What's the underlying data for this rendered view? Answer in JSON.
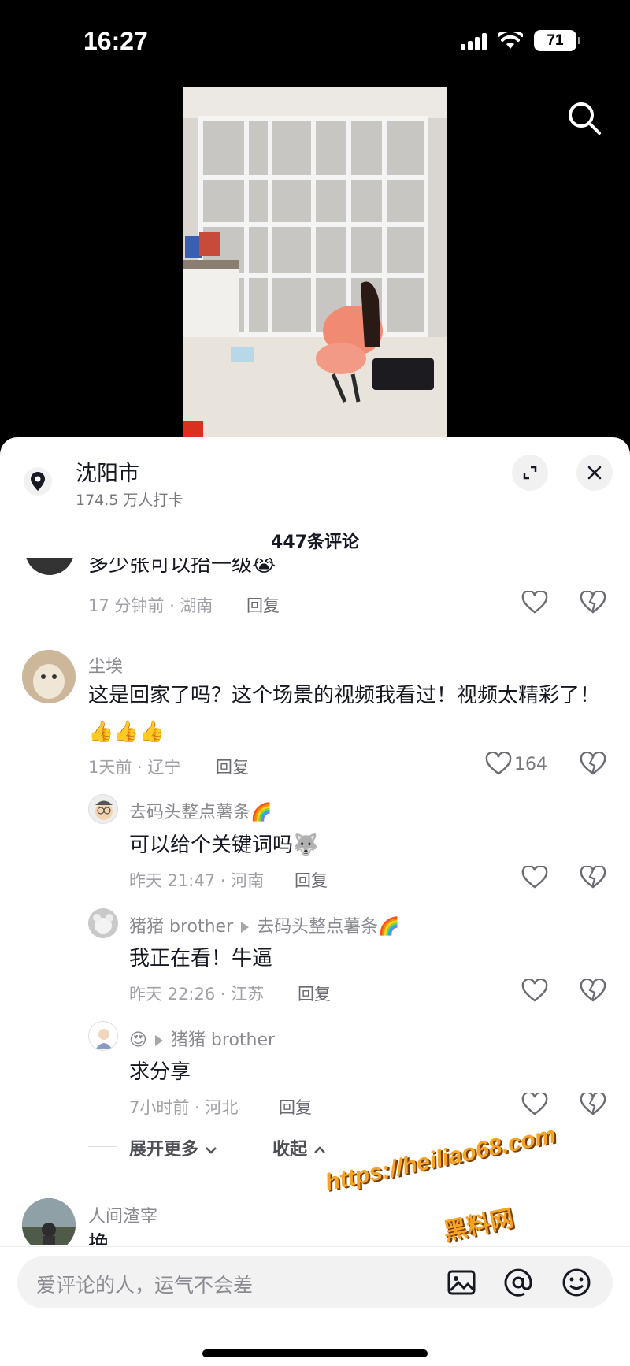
{
  "status": {
    "time": "16:27",
    "battery": "71"
  },
  "location": {
    "title": "沈阳市",
    "checkins": "174.5 万人打卡"
  },
  "comment_count": "447条评论",
  "comments": [
    {
      "text": "多少张可以抬一级😭",
      "meta": "17 分钟前 · 湖南",
      "reply": "回复"
    },
    {
      "user": "尘埃",
      "text": "这是回家了吗？这个场景的视频我看过！视频太精彩了！👍👍👍",
      "meta": "1天前 · 辽宁",
      "reply": "回复",
      "likes": "164"
    },
    {
      "user": "去码头整点薯条🌈",
      "text": "可以给个关键词吗🐺",
      "meta": "昨天 21:47 · 河南",
      "reply": "回复"
    },
    {
      "user": "猪猪 brother",
      "reply_to": "去码头整点薯条🌈",
      "text": "我正在看！牛逼",
      "meta": "昨天 22:26 · 江苏",
      "reply": "回复"
    },
    {
      "user": "😍",
      "reply_to": "猪猪 brother",
      "text": "求分享",
      "meta": "7小时前 · 河北",
      "reply": "回复"
    },
    {
      "user": "人间渣宰",
      "text": "挽"
    }
  ],
  "thread": {
    "expand": "展开更多",
    "collapse": "收起"
  },
  "watermark": {
    "url": "https://heiliao68.com",
    "name": "黑料网"
  },
  "input": {
    "placeholder": "爱评论的人，运气不会差"
  },
  "icons": [
    "location-pin-icon",
    "expand-icon",
    "close-icon",
    "search-icon",
    "heart-icon",
    "broken-heart-icon",
    "image-icon",
    "at-icon",
    "emoji-icon",
    "chevron-down-icon",
    "chevron-up-icon"
  ]
}
